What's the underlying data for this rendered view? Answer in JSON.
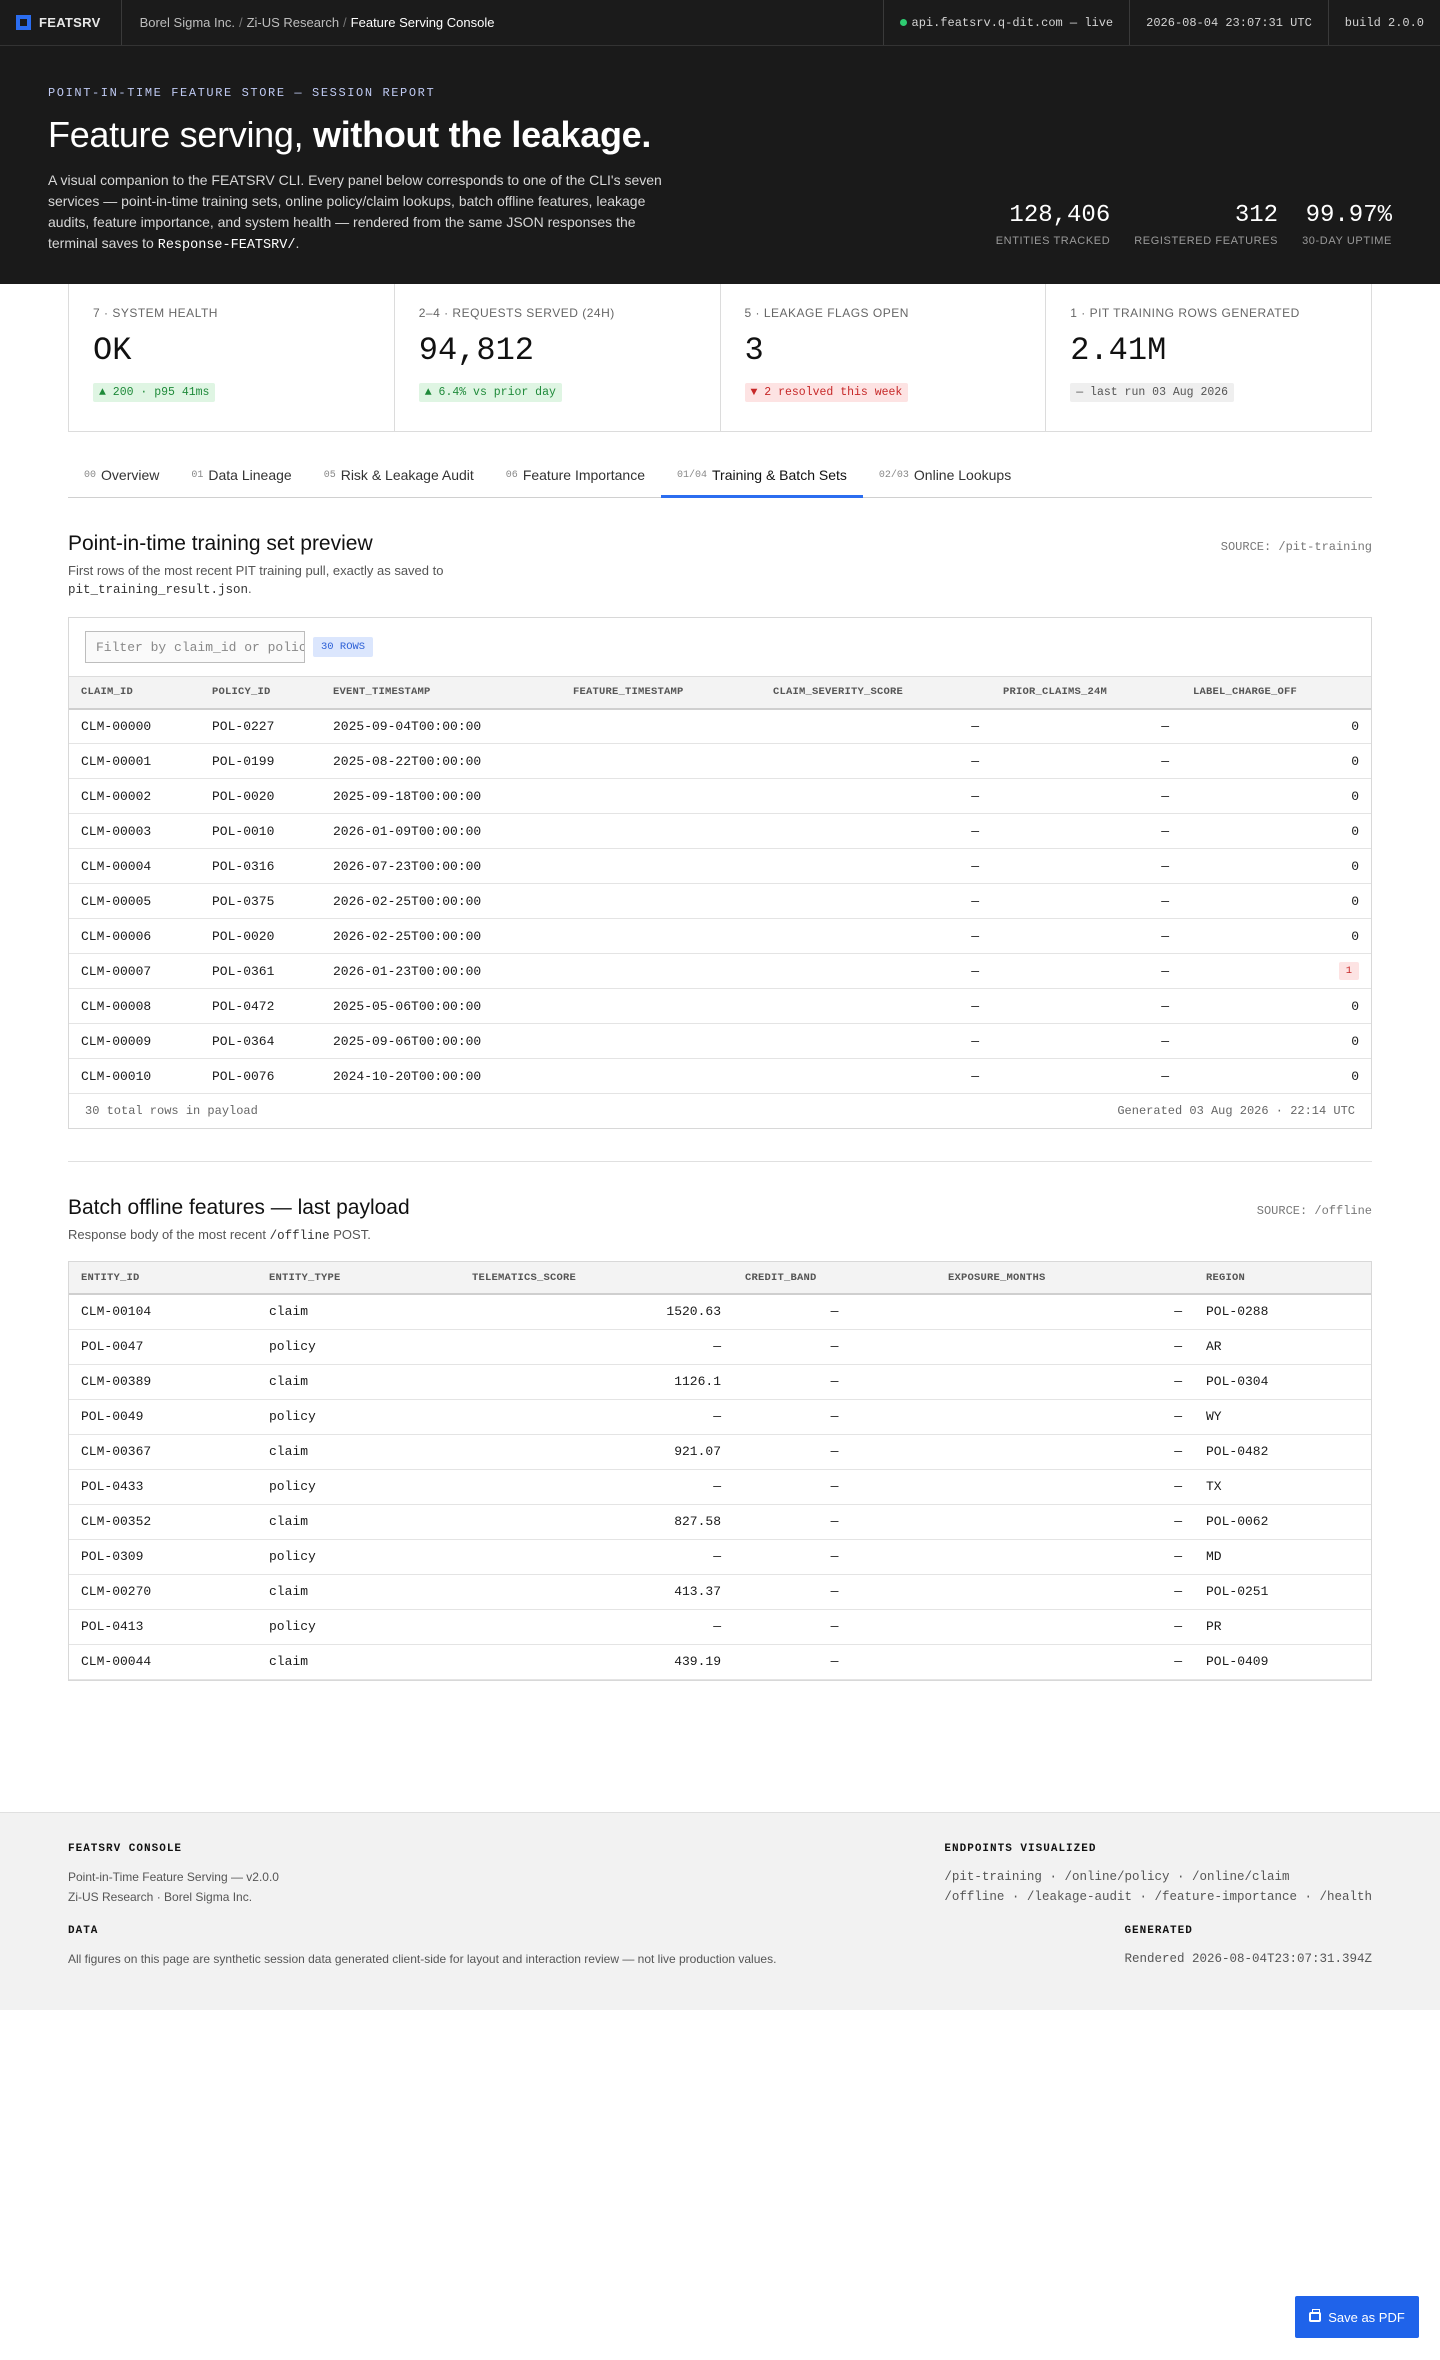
{
  "topbar": {
    "brand": "FEATSRV",
    "crumbs": [
      "Borel Sigma Inc.",
      "Zi-US Research",
      "Feature Serving Console"
    ],
    "api": "api.featsrv.q-dit.com — live",
    "timestamp": "2026-08-04 23:07:31 UTC",
    "build": "build 2.0.0"
  },
  "hero": {
    "eyebrow": "POINT-IN-TIME FEATURE STORE — SESSION REPORT",
    "title_plain": "Feature serving, ",
    "title_bold": "without the leakage.",
    "desc_main": "A visual companion to the FEATSRV CLI. Every panel below corresponds to one of the CLI's seven services — point-in-time training sets, online policy/claim lookups, batch offline features, leakage audits, feature importance, and system health — rendered from the same JSON responses the terminal saves to ",
    "desc_code": "Response-FEATSRV/",
    "desc_end": ".",
    "stats": [
      {
        "value": "128,406",
        "label": "ENTITIES TRACKED"
      },
      {
        "value": "312",
        "label": "REGISTERED FEATURES"
      },
      {
        "value": "99.97%",
        "label": "30-DAY UPTIME"
      }
    ]
  },
  "kpis": [
    {
      "label": "7 · SYSTEM HEALTH",
      "value": "OK",
      "chip": "▲ 200 · p95 41ms",
      "tone": "up"
    },
    {
      "label": "2–4 · REQUESTS SERVED (24H)",
      "value": "94,812",
      "chip": "▲ 6.4% vs prior day",
      "tone": "up"
    },
    {
      "label": "5 · LEAKAGE FLAGS OPEN",
      "value": "3",
      "chip": "▼ 2 resolved this week",
      "tone": "down"
    },
    {
      "label": "1 · PIT TRAINING ROWS GENERATED",
      "value": "2.41M",
      "chip": "— last run 03 Aug 2026",
      "tone": "neutral"
    }
  ],
  "tabs": [
    {
      "num": "00",
      "label": "Overview"
    },
    {
      "num": "01",
      "label": "Data Lineage"
    },
    {
      "num": "05",
      "label": "Risk & Leakage Audit"
    },
    {
      "num": "06",
      "label": "Feature Importance"
    },
    {
      "num": "01/04",
      "label": "Training & Batch Sets"
    },
    {
      "num": "02/03",
      "label": "Online Lookups"
    }
  ],
  "pit": {
    "title": "Point-in-time training set preview",
    "sub_main": "First rows of the most recent PIT training pull, exactly as saved to",
    "sub_code": "pit_training_result.json",
    "sub_end": ".",
    "source": "SOURCE: /pit-training",
    "filter_placeholder": "Filter by claim_id or policy_id",
    "rows_chip": "30 ROWS",
    "columns": [
      "CLAIM_ID",
      "POLICY_ID",
      "EVENT_TIMESTAMP",
      "FEATURE_TIMESTAMP",
      "CLAIM_SEVERITY_SCORE",
      "PRIOR_CLAIMS_24M",
      "LABEL_CHARGE_OFF"
    ],
    "rows": [
      [
        "CLM-00000",
        "POL-0227",
        "2025-09-04T00:00:00",
        "",
        "—",
        "—",
        "0"
      ],
      [
        "CLM-00001",
        "POL-0199",
        "2025-08-22T00:00:00",
        "",
        "—",
        "—",
        "0"
      ],
      [
        "CLM-00002",
        "POL-0020",
        "2025-09-18T00:00:00",
        "",
        "—",
        "—",
        "0"
      ],
      [
        "CLM-00003",
        "POL-0010",
        "2026-01-09T00:00:00",
        "",
        "—",
        "—",
        "0"
      ],
      [
        "CLM-00004",
        "POL-0316",
        "2026-07-23T00:00:00",
        "",
        "—",
        "—",
        "0"
      ],
      [
        "CLM-00005",
        "POL-0375",
        "2026-02-25T00:00:00",
        "",
        "—",
        "—",
        "0"
      ],
      [
        "CLM-00006",
        "POL-0020",
        "2026-02-25T00:00:00",
        "",
        "—",
        "—",
        "0"
      ],
      [
        "CLM-00007",
        "POL-0361",
        "2026-01-23T00:00:00",
        "",
        "—",
        "—",
        "1"
      ],
      [
        "CLM-00008",
        "POL-0472",
        "2025-05-06T00:00:00",
        "",
        "—",
        "—",
        "0"
      ],
      [
        "CLM-00009",
        "POL-0364",
        "2025-09-06T00:00:00",
        "",
        "—",
        "—",
        "0"
      ],
      [
        "CLM-00010",
        "POL-0076",
        "2024-10-20T00:00:00",
        "",
        "—",
        "—",
        "0"
      ]
    ],
    "foot_left": "30 total rows in payload",
    "foot_right": "Generated 03 Aug 2026 · 22:14 UTC"
  },
  "batch": {
    "title": "Batch offline features — last payload",
    "sub_main": "Response body of the most recent ",
    "sub_code": "/offline",
    "sub_end": " POST.",
    "source": "SOURCE: /offline",
    "columns": [
      "ENTITY_ID",
      "ENTITY_TYPE",
      "TELEMATICS_SCORE",
      "CREDIT_BAND",
      "EXPOSURE_MONTHS",
      "REGION"
    ],
    "rows": [
      [
        "CLM-00104",
        "claim",
        "1520.63",
        "—",
        "—",
        "POL-0288"
      ],
      [
        "POL-0047",
        "policy",
        "—",
        "—",
        "—",
        "AR"
      ],
      [
        "CLM-00389",
        "claim",
        "1126.1",
        "—",
        "—",
        "POL-0304"
      ],
      [
        "POL-0049",
        "policy",
        "—",
        "—",
        "—",
        "WY"
      ],
      [
        "CLM-00367",
        "claim",
        "921.07",
        "—",
        "—",
        "POL-0482"
      ],
      [
        "POL-0433",
        "policy",
        "—",
        "—",
        "—",
        "TX"
      ],
      [
        "CLM-00352",
        "claim",
        "827.58",
        "—",
        "—",
        "POL-0062"
      ],
      [
        "POL-0309",
        "policy",
        "—",
        "—",
        "—",
        "MD"
      ],
      [
        "CLM-00270",
        "claim",
        "413.37",
        "—",
        "—",
        "POL-0251"
      ],
      [
        "POL-0413",
        "policy",
        "—",
        "—",
        "—",
        "PR"
      ],
      [
        "CLM-00044",
        "claim",
        "439.19",
        "—",
        "—",
        "POL-0409"
      ]
    ]
  },
  "footer": {
    "console_h": "FEATSRV CONSOLE",
    "console_l1": "Point-in-Time Feature Serving — v2.0.0",
    "console_l2": "Zi-US Research · Borel Sigma Inc.",
    "data_h": "DATA",
    "data_t": "All figures on this page are synthetic session data generated client-side for layout and interaction review — not live production values.",
    "endpoints_h": "ENDPOINTS VISUALIZED",
    "endpoints_l1": "/pit-training · /online/policy · /online/claim",
    "endpoints_l2": "/offline · /leakage-audit · /feature-importance · /health",
    "generated_h": "GENERATED",
    "generated_t": "Rendered 2026-08-04T23:07:31.394Z"
  },
  "pdf_button": "Save as PDF",
  "colors": {
    "accent": "#2b6df0",
    "dark": "#1a1a1a",
    "up": "#1f8a3a",
    "down": "#c62828"
  }
}
